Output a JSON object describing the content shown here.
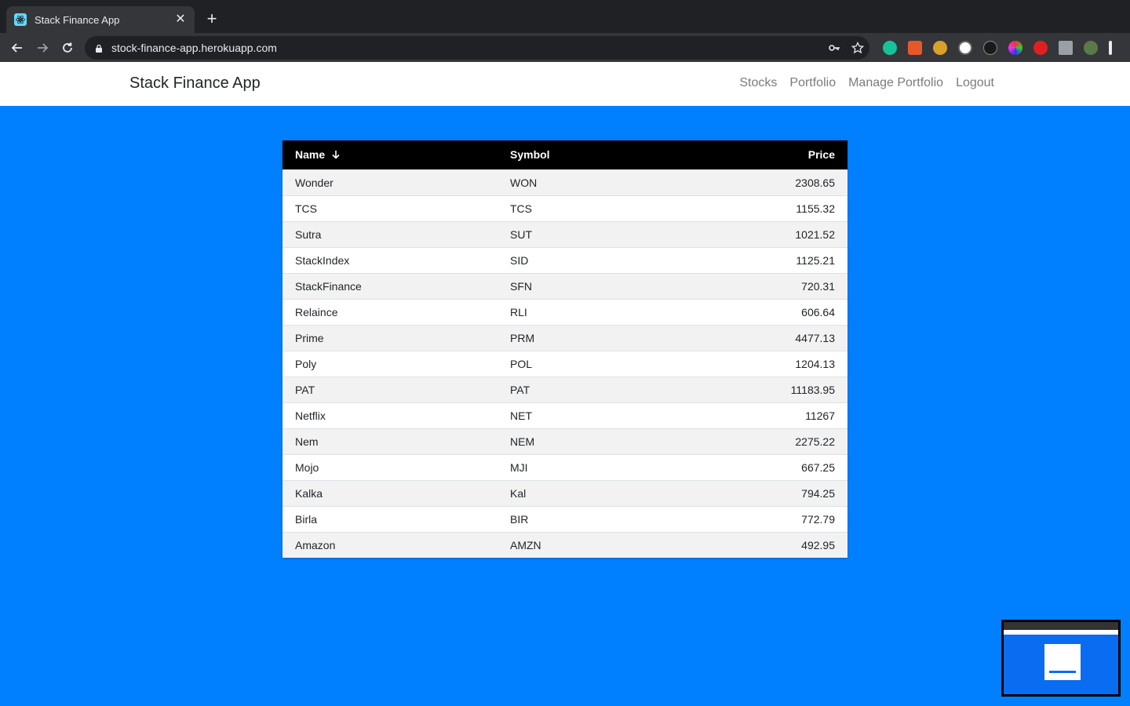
{
  "browser": {
    "tab_title": "Stack Finance App",
    "url": "stock-finance-app.herokuapp.com"
  },
  "app": {
    "brand": "Stack Finance App",
    "nav": [
      "Stocks",
      "Portfolio",
      "Manage Portfolio",
      "Logout"
    ]
  },
  "table": {
    "headers": {
      "name": "Name",
      "symbol": "Symbol",
      "price": "Price"
    },
    "sort": {
      "column": "name",
      "direction": "descending"
    },
    "rows": [
      {
        "name": "Wonder",
        "symbol": "WON",
        "price": "2308.65"
      },
      {
        "name": "TCS",
        "symbol": "TCS",
        "price": "1155.32"
      },
      {
        "name": "Sutra",
        "symbol": "SUT",
        "price": "1021.52"
      },
      {
        "name": "StackIndex",
        "symbol": "SID",
        "price": "1125.21"
      },
      {
        "name": "StackFinance",
        "symbol": "SFN",
        "price": "720.31"
      },
      {
        "name": "Relaince",
        "symbol": "RLI",
        "price": "606.64"
      },
      {
        "name": "Prime",
        "symbol": "PRM",
        "price": "4477.13"
      },
      {
        "name": "Poly",
        "symbol": "POL",
        "price": "1204.13"
      },
      {
        "name": "PAT",
        "symbol": "PAT",
        "price": "11183.95"
      },
      {
        "name": "Netflix",
        "symbol": "NET",
        "price": "11267"
      },
      {
        "name": "Nem",
        "symbol": "NEM",
        "price": "2275.22"
      },
      {
        "name": "Mojo",
        "symbol": "MJI",
        "price": "667.25"
      },
      {
        "name": "Kalka",
        "symbol": "Kal",
        "price": "794.25"
      },
      {
        "name": "Birla",
        "symbol": "BIR",
        "price": "772.79"
      },
      {
        "name": "Amazon",
        "symbol": "AMZN",
        "price": "492.95"
      }
    ]
  },
  "colors": {
    "page_background": "#0080ff",
    "table_header": "#000000",
    "navbar": "#ffffff"
  }
}
